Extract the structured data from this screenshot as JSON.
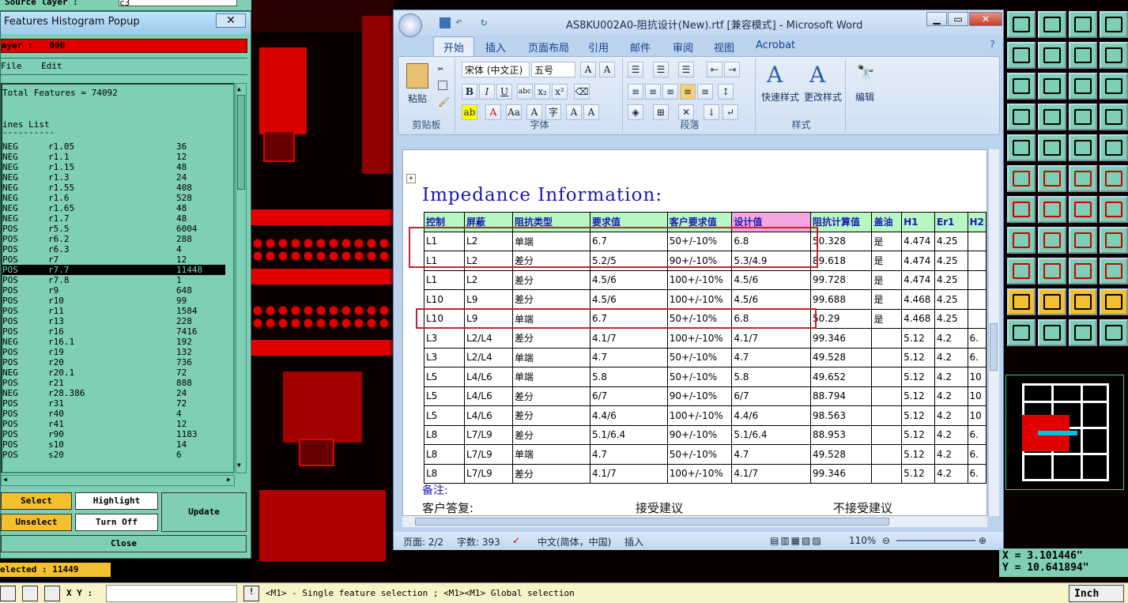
{
  "source_layer": {
    "label": "Source layer :",
    "value": "c3"
  },
  "features": {
    "title": "Features Histogram Popup",
    "close_x": "✕",
    "layer_label": "ayer :",
    "layer_value": "000",
    "menu": [
      "File",
      "Edit"
    ],
    "total": "Total Features = 74092",
    "lines_list": "ines List",
    "rows": [
      [
        "NEG",
        "r1.05",
        "36"
      ],
      [
        "NEG",
        "r1.1",
        "12"
      ],
      [
        "NEG",
        "r1.15",
        "48"
      ],
      [
        "NEG",
        "r1.3",
        "24"
      ],
      [
        "NEG",
        "r1.55",
        "408"
      ],
      [
        "NEG",
        "r1.6",
        "528"
      ],
      [
        "NEG",
        "r1.65",
        "48"
      ],
      [
        "NEG",
        "r1.7",
        "48"
      ],
      [
        "POS",
        "r5.5",
        "6004"
      ],
      [
        "POS",
        "r6.2",
        "288"
      ],
      [
        "POS",
        "r6.3",
        "4"
      ],
      [
        "POS",
        "r7",
        "12"
      ],
      [
        "POS",
        "r7.7",
        "11448"
      ],
      [
        "POS",
        "r7.8",
        "1"
      ],
      [
        "POS",
        "r9",
        "648"
      ],
      [
        "POS",
        "r10",
        "99"
      ],
      [
        "POS",
        "r11",
        "1584"
      ],
      [
        "POS",
        "r13",
        "228"
      ],
      [
        "POS",
        "r16",
        "7416"
      ],
      [
        "NEG",
        "r16.1",
        "192"
      ],
      [
        "POS",
        "r19",
        "132"
      ],
      [
        "POS",
        "r20",
        "736"
      ],
      [
        "NEG",
        "r20.1",
        "72"
      ],
      [
        "POS",
        "r21",
        "888"
      ],
      [
        "NEG",
        "r28.386",
        "24"
      ],
      [
        "POS",
        "r31",
        "72"
      ],
      [
        "POS",
        "r40",
        "4"
      ],
      [
        "POS",
        "r41",
        "12"
      ],
      [
        "POS",
        "r90",
        "1183"
      ],
      [
        "POS",
        "s10",
        "14"
      ],
      [
        "POS",
        "s20",
        "6"
      ]
    ],
    "buttons": {
      "select": "Select",
      "highlight": "Highlight",
      "update": "Update",
      "unselect": "Unselect",
      "turn_off": "Turn Off",
      "close": "Close"
    }
  },
  "selected": "elected : 11449",
  "bottom": {
    "xy_label": "X Y :",
    "message": "<M1> - Single feature selection ; <M1><M1> Global selection",
    "units": "Inch"
  },
  "coords": {
    "x": "X = 3.101446\"",
    "y": "Y = 10.641894\""
  },
  "word": {
    "title": "AS8KU002A0-阻抗设计(New).rtf [兼容模式] - Microsoft Word",
    "tabs": [
      "开始",
      "插入",
      "页面布局",
      "引用",
      "邮件",
      "审阅",
      "视图",
      "Acrobat"
    ],
    "ribbon": {
      "paste": "粘贴",
      "clipboard": "剪贴板",
      "font": "宋体 (中文正)",
      "size": "五号",
      "font_group": "字体",
      "para_group": "段落",
      "quick_style": "快速样式",
      "change_style": "更改样式",
      "style_group": "样式",
      "edit": "编辑"
    },
    "doc_title": "Impedance Information:",
    "columns": [
      "控制",
      "屏蔽",
      "阻抗类型",
      "要求值",
      "客户要求值",
      "设计值",
      "阻抗计算值",
      "盖油",
      "H1",
      "Er1",
      "H2"
    ],
    "rows": [
      [
        "L1",
        "L2",
        "单端",
        "6.7",
        "50+/-10%",
        "6.8",
        "50.328",
        "是",
        "4.474",
        "4.25",
        ""
      ],
      [
        "L1",
        "L2",
        "差分",
        "5.2/5",
        "90+/-10%",
        "5.3/4.9",
        "89.618",
        "是",
        "4.474",
        "4.25",
        ""
      ],
      [
        "L1",
        "L2",
        "差分",
        "4.5/6",
        "100+/-10%",
        "4.5/6",
        "99.728",
        "是",
        "4.474",
        "4.25",
        ""
      ],
      [
        "L10",
        "L9",
        "差分",
        "4.5/6",
        "100+/-10%",
        "4.5/6",
        "99.688",
        "是",
        "4.468",
        "4.25",
        ""
      ],
      [
        "L10",
        "L9",
        "单端",
        "6.7",
        "50+/-10%",
        "6.8",
        "50.29",
        "是",
        "4.468",
        "4.25",
        ""
      ],
      [
        "L3",
        "L2/L4",
        "差分",
        "4.1/7",
        "100+/-10%",
        "4.1/7",
        "99.346",
        "",
        "5.12",
        "4.2",
        "6."
      ],
      [
        "L3",
        "L2/L4",
        "单端",
        "4.7",
        "50+/-10%",
        "4.7",
        "49.528",
        "",
        "5.12",
        "4.2",
        "6."
      ],
      [
        "L5",
        "L4/L6",
        "单端",
        "5.8",
        "50+/-10%",
        "5.8",
        "49.652",
        "",
        "5.12",
        "4.2",
        "10"
      ],
      [
        "L5",
        "L4/L6",
        "差分",
        "6/7",
        "90+/-10%",
        "6/7",
        "88.794",
        "",
        "5.12",
        "4.2",
        "10"
      ],
      [
        "L5",
        "L4/L6",
        "差分",
        "4.4/6",
        "100+/-10%",
        "4.4/6",
        "98.563",
        "",
        "5.12",
        "4.2",
        "10"
      ],
      [
        "L8",
        "L7/L9",
        "差分",
        "5.1/6.4",
        "90+/-10%",
        "5.1/6.4",
        "88.953",
        "",
        "5.12",
        "4.2",
        "6."
      ],
      [
        "L8",
        "L7/L9",
        "单端",
        "4.7",
        "50+/-10%",
        "4.7",
        "49.528",
        "",
        "5.12",
        "4.2",
        "6."
      ],
      [
        "L8",
        "L7/L9",
        "差分",
        "4.1/7",
        "100+/-10%",
        "4.1/7",
        "99.346",
        "",
        "5.12",
        "4.2",
        "6."
      ]
    ],
    "notes": "备注:",
    "reply": "客户答复:",
    "accept": "接受建议",
    "reject": "不接受建议",
    "status": {
      "page": "页面: 2/2",
      "words": "字数: 393",
      "lang": "中文(简体，中国)",
      "insert": "插入",
      "zoom": "110%"
    }
  }
}
